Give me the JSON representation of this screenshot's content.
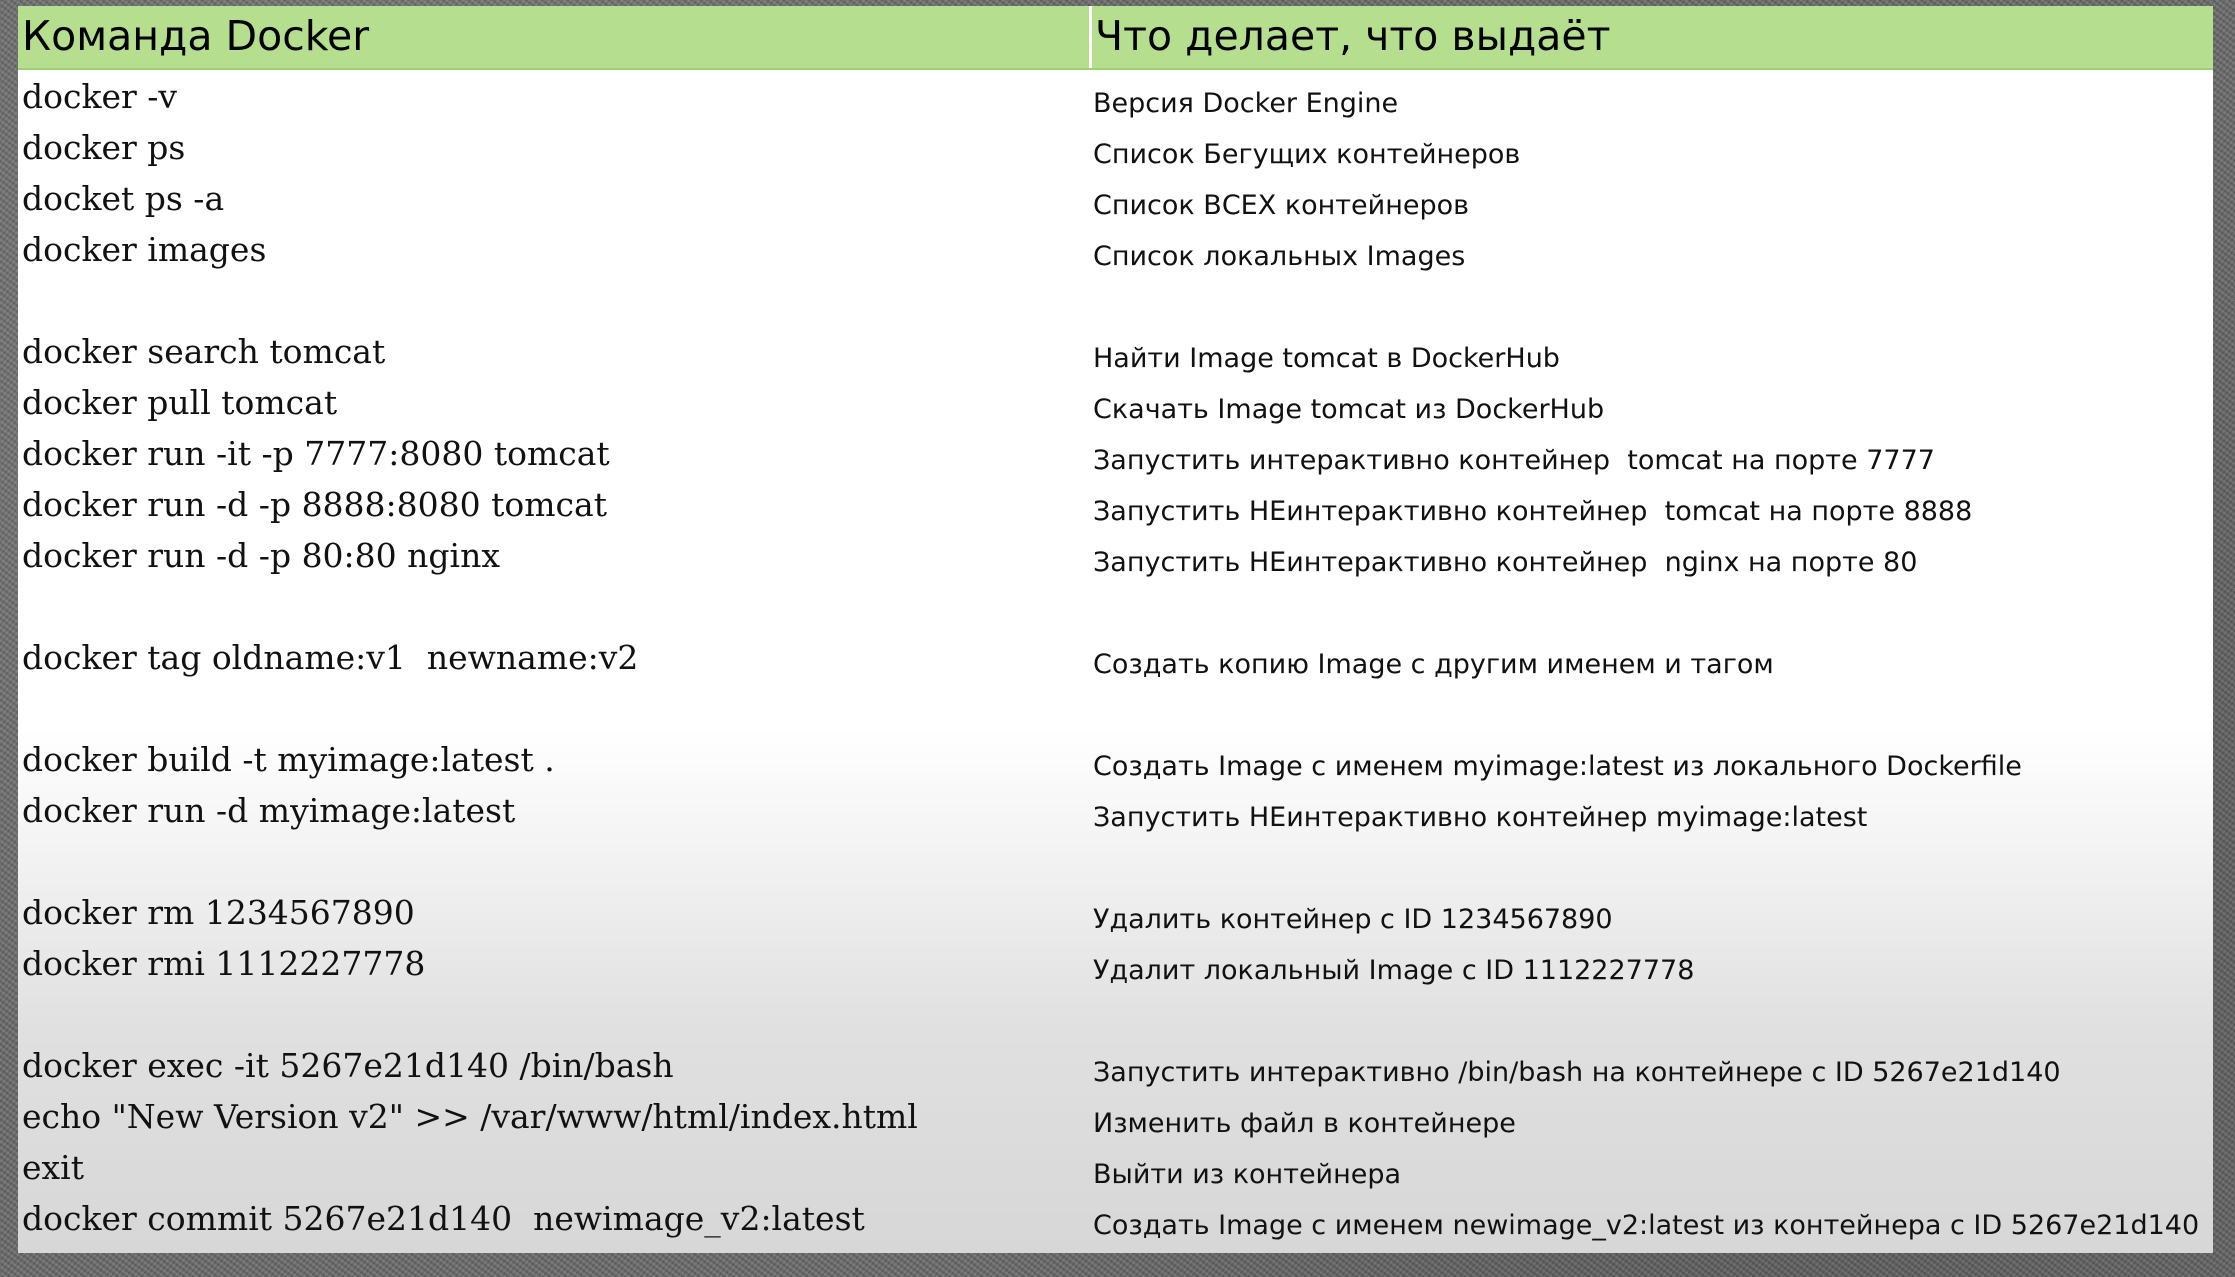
{
  "header": {
    "command_col": "Команда Docker",
    "description_col": "Что делает, что выдаёт"
  },
  "rows": [
    {
      "cmd": "docker -v",
      "desc": "Версия Docker Engine"
    },
    {
      "cmd": "docker ps",
      "desc": "Список Бегущих контейнеров"
    },
    {
      "cmd": "docket ps -a",
      "desc": "Список ВСЕХ контейнеров"
    },
    {
      "cmd": "docker images",
      "desc": "Список локальных Images"
    },
    {
      "cmd": "docker search tomcat",
      "desc": "Найти Image tomcat в DockerHub"
    },
    {
      "cmd": "docker pull tomcat",
      "desc": "Скачать Image tomcat из DockerHub"
    },
    {
      "cmd": "docker run -it -p 7777:8080 tomcat",
      "desc": "Запустить интерактивно контейнер  tomcat на порте 7777"
    },
    {
      "cmd": "docker run -d -p 8888:8080 tomcat",
      "desc": "Запустить НЕинтерактивно контейнер  tomcat на порте 8888"
    },
    {
      "cmd": "docker run -d -p 80:80 nginx",
      "desc": "Запустить НЕинтерактивно контейнер  nginx на порте 80"
    },
    {
      "cmd": "docker tag oldname:v1  newname:v2",
      "desc": "Создать копию Image с другим именем и тагом"
    },
    {
      "cmd": "docker build -t myimage:latest .",
      "desc": "Создать Image с именем myimage:latest из локального Dockerfile"
    },
    {
      "cmd": "docker run -d myimage:latest",
      "desc": "Запустить НЕинтерактивно контейнер myimage:latest"
    },
    {
      "cmd": "docker rm 1234567890",
      "desc": "Удалить контейнер с ID 1234567890"
    },
    {
      "cmd": "docker rmi 1112227778",
      "desc": "Удалит локальный Image с ID 1112227778"
    },
    {
      "cmd": "docker exec -it 5267e21d140 /bin/bash",
      "desc": "Запустить интерактивно /bin/bash на контейнере с ID 5267e21d140"
    },
    {
      "cmd": "echo \"New Version v2\" >> /var/www/html/index.html",
      "desc": "Изменить файл в контейнере"
    },
    {
      "cmd": "exit",
      "desc": "Выйти из контейнера"
    },
    {
      "cmd": "docker commit 5267e21d140  newimage_v2:latest",
      "desc": "Создать Image с именем newimage_v2:latest из контейнера с ID 5267e21d140"
    }
  ]
}
